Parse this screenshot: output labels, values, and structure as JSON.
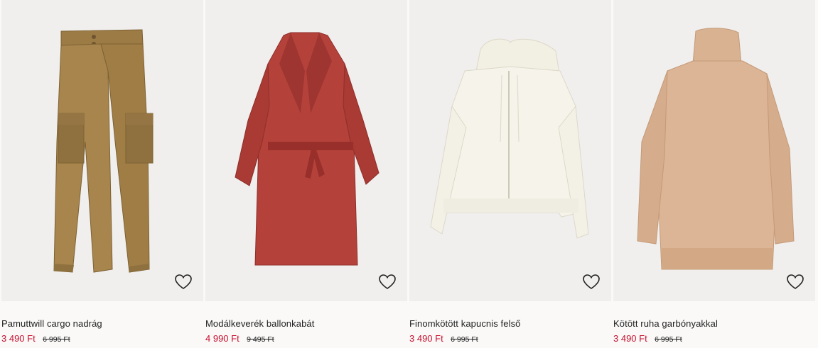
{
  "products": [
    {
      "name": "Pamuttwill cargo nadrág",
      "price": "3 490 Ft",
      "old_price": "6 995 Ft",
      "image_icon": "cargo-pants",
      "color": "#9c7b45"
    },
    {
      "name": "Modálkeverék ballonkabát",
      "price": "4 990 Ft",
      "old_price": "9 495 Ft",
      "image_icon": "trench-coat",
      "color": "#b4423b"
    },
    {
      "name": "Finomkötött kapucnis felső",
      "price": "3 490 Ft",
      "old_price": "6 995 Ft",
      "image_icon": "hooded-cardigan",
      "color": "#f6f4ea"
    },
    {
      "name": "Kötött ruha garbónyakkal",
      "price": "3 490 Ft",
      "old_price": "6 995 Ft",
      "image_icon": "knit-dress",
      "color": "#dcb596"
    }
  ],
  "favorite_icon": "heart-outline-icon",
  "colors": {
    "sale_price": "#c8102e",
    "text": "#222222",
    "image_bg": "#f0efee",
    "page_bg": "#faf9f8"
  }
}
